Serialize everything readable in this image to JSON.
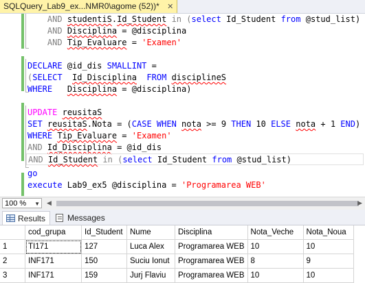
{
  "tab": {
    "title": "SQLQuery_Lab9_ex...NMR0\\agome (52))*",
    "close": "✕"
  },
  "code": {
    "l1": {
      "kw1": "AND",
      "t1": "studentiS",
      "t2": ".",
      "t3": "Id_Student",
      "op1": "in",
      "t4": "(",
      "kw2": "select",
      "t5": "Id_Student",
      "kw3": "from",
      "t6": "@stud_list)"
    },
    "l2": {
      "kw1": "AND",
      "t1": "Disciplina",
      "t2": " = @disciplina"
    },
    "l3": {
      "kw1": "AND",
      "t1": "Tip_Evaluare",
      "t2": " = ",
      "s1": "'Examen'"
    },
    "l5": {
      "kw1": "DECLARE",
      "t1": " @id_dis ",
      "kw2": "SMALLINT",
      "t2": " ="
    },
    "l6": {
      "t0": "(",
      "kw1": "SELECT",
      "t1": "  ",
      "t2": "Id_Disciplina",
      "t3": "  ",
      "kw2": "FROM",
      "t4": " ",
      "t5": "disciplineS"
    },
    "l7": {
      "kw1": "WHERE",
      "t1": "   ",
      "t2": "Disciplina",
      "t3": " = @disciplina)"
    },
    "l9": {
      "kw1": "UPDATE",
      "t1": " ",
      "t2": "reusitaS"
    },
    "l10": {
      "kw1": "SET",
      "t1": " ",
      "t2": "reusitaS",
      "t3": ".",
      "t4": "Nota",
      "t5": " = (",
      "kw2": "CASE WHEN",
      "t6": " ",
      "t7": "nota",
      "t8": " >= 9 ",
      "kw3": "THEN",
      "t9": " 10 ",
      "kw4": "ELSE",
      "t10": " ",
      "t11": "nota",
      "t12": " + 1 ",
      "kw5": "END",
      "t13": ")"
    },
    "l11": {
      "kw1": "WHERE",
      "t1": " ",
      "t2": "Tip_Evaluare",
      "t3": " = ",
      "s1": "'Examen'"
    },
    "l12": {
      "kw1": "AND",
      "t1": " ",
      "t2": "Id_Disciplina",
      "t3": " = @id_dis"
    },
    "l13": {
      "kw1": "AND",
      "t1": " ",
      "t2": "Id_Student",
      "t3": " ",
      "op1": "in",
      "t4": " (",
      "kw2": "select",
      "t5": " Id_Student ",
      "kw3": "from",
      "t6": " @stud_list)"
    },
    "l15": {
      "kw1": "go"
    },
    "l16": {
      "kw1": "execute",
      "t1": " Lab9_ex5 @disciplina = ",
      "s1": "'Programarea WEB'"
    }
  },
  "zoom": {
    "value": "100 %"
  },
  "results_tabs": {
    "results": "Results",
    "messages": "Messages"
  },
  "grid": {
    "columns": [
      "cod_grupa",
      "Id_Student",
      "Nume",
      "Disciplina",
      "Nota_Veche",
      "Nota_Noua"
    ],
    "rows": [
      {
        "n": "1",
        "cod_grupa": "TI171",
        "id": "127",
        "nume": "Luca Alex",
        "disc": "Programarea WEB",
        "veche": "10",
        "noua": "10"
      },
      {
        "n": "2",
        "cod_grupa": "INF171",
        "id": "150",
        "nume": "Suciu Ionut",
        "disc": "Programarea WEB",
        "veche": "8",
        "noua": "9"
      },
      {
        "n": "3",
        "cod_grupa": "INF171",
        "id": "159",
        "nume": "Jurj Flaviu",
        "disc": "Programarea WEB",
        "veche": "10",
        "noua": "10"
      }
    ]
  },
  "colors": {
    "keyword": "#0000ff",
    "string": "#ff0000",
    "gray": "#808080",
    "changebar": "#74c16a",
    "tab": "#fff3a8"
  }
}
